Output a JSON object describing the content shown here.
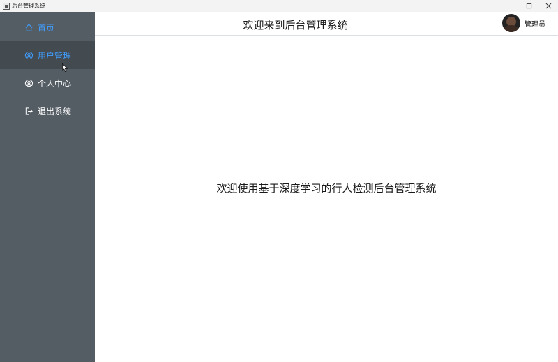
{
  "window": {
    "title": "后台管理系统"
  },
  "sidebar": {
    "items": [
      {
        "label": "首页",
        "icon": "home-icon"
      },
      {
        "label": "用户管理",
        "icon": "user-manage-icon"
      },
      {
        "label": "个人中心",
        "icon": "user-circle-icon"
      },
      {
        "label": "退出系统",
        "icon": "logout-icon"
      }
    ],
    "active_color": "#409eff",
    "background": "#545c64"
  },
  "header": {
    "title": "欢迎来到后台管理系统",
    "user_name": "管理员"
  },
  "main": {
    "welcome_text": "欢迎使用基于深度学习的行人检测后台管理系统"
  }
}
